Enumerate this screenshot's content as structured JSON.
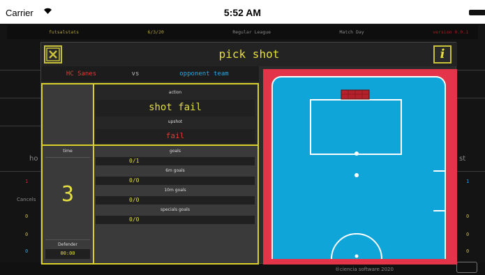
{
  "status_bar": {
    "carrier": "Carrier",
    "time": "5:52 AM"
  },
  "background": {
    "topbar": [
      "futsalstats",
      "6/3/20",
      "Regular League",
      "Match Day",
      "version 0.0.1"
    ],
    "left_labels": [
      "ho",
      "Cancels"
    ],
    "right_labels": [
      "st"
    ],
    "footer": "®ciencia software 2020",
    "row_values": [
      "1",
      "0",
      "0",
      "0"
    ]
  },
  "modal": {
    "title": "pick shot",
    "teams": {
      "home": "HC Sanes",
      "vs": "vs",
      "away": "opponent team"
    },
    "action": {
      "label": "action",
      "value": "shot fail"
    },
    "upshot": {
      "label": "upshot",
      "value": "fail"
    },
    "time": {
      "label": "time",
      "value": "3"
    },
    "defender": {
      "label": "Defender",
      "value": "00:00"
    },
    "stats": [
      {
        "label": "goals",
        "value": "0/1"
      },
      {
        "label": "6m goals",
        "value": "0/0"
      },
      {
        "label": "10m goals",
        "value": "0/0"
      },
      {
        "label": "specials goals",
        "value": "0/0"
      }
    ]
  },
  "colors": {
    "accent": "#d9d02a",
    "home": "#e23a3a",
    "away": "#2aa6e0",
    "court": "#10a5d8",
    "court_border": "#e43449"
  }
}
